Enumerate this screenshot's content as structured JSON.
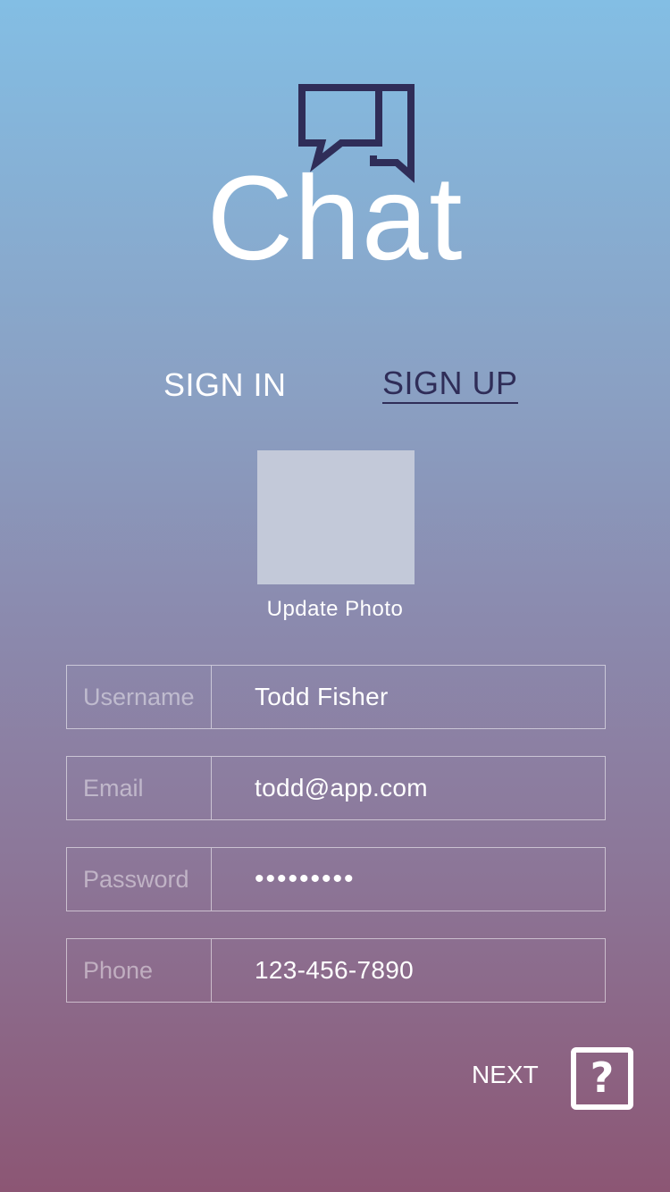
{
  "logo": {
    "text": "Chat",
    "icon": "chat-bubbles-icon",
    "icon_color": "#2f2d58"
  },
  "tabs": [
    {
      "label": "SIGN IN",
      "active": false
    },
    {
      "label": "SIGN UP",
      "active": true
    }
  ],
  "photo": {
    "label": "Update Photo"
  },
  "fields": [
    {
      "label": "Username",
      "value": "Todd Fisher"
    },
    {
      "label": "Email",
      "value": "todd@app.com"
    },
    {
      "label": "Password",
      "value": "•••••••••"
    },
    {
      "label": "Phone",
      "value": "123-456-7890"
    }
  ],
  "footer": {
    "next_label": "NEXT",
    "help_icon": "question-mark-icon",
    "help_glyph": "?"
  },
  "colors": {
    "accent": "#2f2d58",
    "gradient_top": "#83bee4",
    "gradient_bottom": "#8c5674"
  }
}
